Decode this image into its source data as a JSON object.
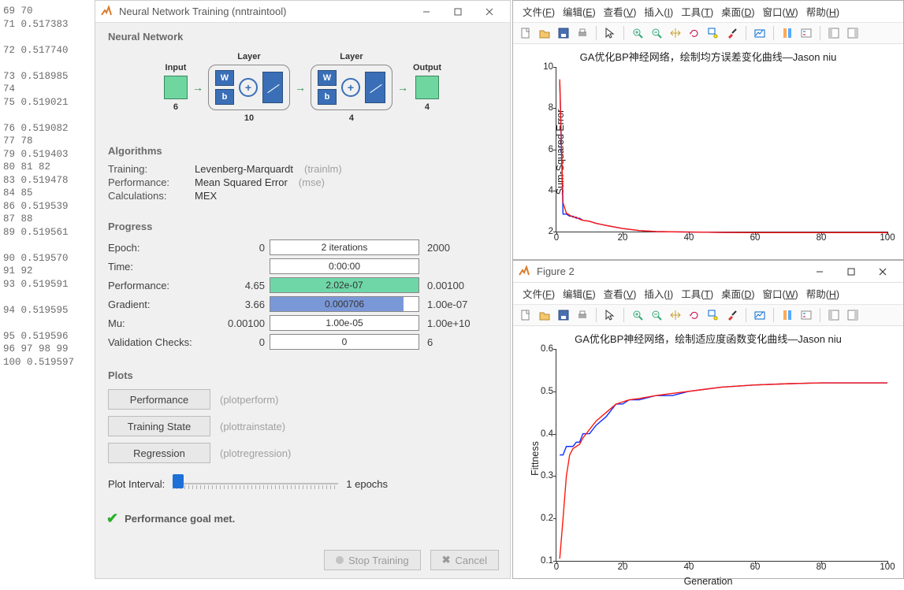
{
  "left_column_text": "69 70\n71 0.517383\n\n72 0.517740\n\n73 0.518985\n74\n75 0.519021\n\n76 0.519082\n77 78\n79 0.519403\n80 81 82\n83 0.519478\n84 85\n86 0.519539\n87 88\n89 0.519561\n\n90 0.519570\n91 92\n93 0.519591\n\n94 0.519595\n\n95 0.519596\n96 97 98 99\n100 0.519597",
  "nntrain": {
    "window_title": "Neural Network Training (nntraintool)",
    "sections": {
      "nn": "Neural Network",
      "algo": "Algorithms",
      "progress": "Progress",
      "plots": "Plots"
    },
    "diagram": {
      "input_label": "Input",
      "input_n": "6",
      "layer_label": "Layer",
      "w_label": "W",
      "b_label": "b",
      "plus": "+",
      "hidden_n": "10",
      "output_layer_n": "4",
      "output_label": "Output",
      "output_n": "4"
    },
    "algorithms": {
      "training_k": "Training:",
      "training_v": "Levenberg-Marquardt",
      "training_h": "(trainlm)",
      "perf_k": "Performance:",
      "perf_v": "Mean Squared Error",
      "perf_h": "(mse)",
      "calc_k": "Calculations:",
      "calc_v": "MEX"
    },
    "progress": {
      "epoch": {
        "k": "Epoch:",
        "start": "0",
        "text": "2 iterations",
        "end": "2000",
        "fill_pct": 0,
        "fill_color": ""
      },
      "time": {
        "k": "Time:",
        "start": "",
        "text": "0:00:00",
        "end": "",
        "fill_pct": 0,
        "fill_color": ""
      },
      "perf": {
        "k": "Performance:",
        "start": "4.65",
        "text": "2.02e-07",
        "end": "0.00100",
        "fill_pct": 100,
        "fill_color": "#6fd6a8"
      },
      "grad": {
        "k": "Gradient:",
        "start": "3.66",
        "text": "0.000706",
        "end": "1.00e-07",
        "fill_pct": 90,
        "fill_color": "#7a98d8"
      },
      "mu": {
        "k": "Mu:",
        "start": "0.00100",
        "text": "1.00e-05",
        "end": "1.00e+10",
        "fill_pct": 0,
        "fill_color": ""
      },
      "valid": {
        "k": "Validation Checks:",
        "start": "0",
        "text": "0",
        "end": "6",
        "fill_pct": 0,
        "fill_color": ""
      }
    },
    "plot_buttons": {
      "perf": {
        "label": "Performance",
        "hint": "(plotperform)"
      },
      "state": {
        "label": "Training State",
        "hint": "(plottrainstate)"
      },
      "reg": {
        "label": "Regression",
        "hint": "(plotregression)"
      }
    },
    "plot_interval": {
      "label": "Plot Interval:",
      "value_text": "1 epochs"
    },
    "status": "Performance goal met.",
    "buttons": {
      "stop": "Stop Training",
      "cancel": "Cancel"
    }
  },
  "figure_menus": [
    "文件(F)",
    "编辑(E)",
    "查看(V)",
    "插入(I)",
    "工具(T)",
    "桌面(D)",
    "窗口(W)",
    "帮助(H)"
  ],
  "fig2_title": "Figure 2",
  "toolbar_icons": [
    "new-file-icon",
    "open-folder-icon",
    "save-icon",
    "print-icon",
    "sep",
    "pointer-icon",
    "sep",
    "zoom-in-icon",
    "zoom-out-icon",
    "pan-icon",
    "rotate-icon",
    "data-cursor-icon",
    "brush-icon",
    "sep",
    "link-plot-icon",
    "sep",
    "colorbar-icon",
    "legend-icon",
    "sep",
    "hide-plot-tools-icon",
    "show-plot-tools-icon"
  ],
  "chart_data": [
    {
      "type": "line",
      "title": "GA优化BP神经网络，绘制均方误差变化曲线—Jason niu",
      "xlabel": "",
      "ylabel": "Sum-Squared Error",
      "xlim": [
        0,
        100
      ],
      "ylim": [
        2,
        10
      ],
      "xticks": [
        0,
        20,
        40,
        60,
        80,
        100
      ],
      "yticks": [
        2,
        4,
        6,
        8,
        10
      ],
      "x": [
        1,
        2,
        3,
        4,
        5,
        6,
        7,
        8,
        10,
        12,
        15,
        20,
        25,
        30,
        40,
        50,
        60,
        70,
        80,
        90,
        100
      ],
      "series": [
        {
          "name": "best",
          "color": "#1030ff",
          "values": [
            9.3,
            2.85,
            2.85,
            2.75,
            2.75,
            2.65,
            2.65,
            2.55,
            2.5,
            2.4,
            2.3,
            2.15,
            2.05,
            2.0,
            1.98,
            1.96,
            1.95,
            1.95,
            1.95,
            1.95,
            1.95
          ]
        },
        {
          "name": "curr",
          "color": "#ff1810",
          "values": [
            9.4,
            3.4,
            2.9,
            2.8,
            2.7,
            2.7,
            2.6,
            2.55,
            2.5,
            2.4,
            2.3,
            2.15,
            2.05,
            2.0,
            1.98,
            1.96,
            1.95,
            1.95,
            1.95,
            1.95,
            1.95
          ]
        }
      ]
    },
    {
      "type": "line",
      "title": "GA优化BP神经网络，绘制适应度函数变化曲线—Jason niu",
      "xlabel": "Generation",
      "ylabel": "Fittness",
      "xlim": [
        0,
        100
      ],
      "ylim": [
        0.1,
        0.6
      ],
      "xticks": [
        0,
        20,
        40,
        60,
        80,
        100
      ],
      "yticks": [
        0.1,
        0.2,
        0.3,
        0.4,
        0.5,
        0.6
      ],
      "x": [
        1,
        2,
        3,
        4,
        5,
        6,
        7,
        8,
        10,
        12,
        15,
        18,
        20,
        22,
        25,
        30,
        35,
        40,
        50,
        60,
        70,
        80,
        90,
        100
      ],
      "series": [
        {
          "name": "best",
          "color": "#1030ff",
          "values": [
            0.35,
            0.35,
            0.37,
            0.37,
            0.37,
            0.38,
            0.38,
            0.4,
            0.4,
            0.42,
            0.44,
            0.47,
            0.47,
            0.48,
            0.48,
            0.49,
            0.49,
            0.5,
            0.51,
            0.515,
            0.518,
            0.52,
            0.52,
            0.52
          ]
        },
        {
          "name": "curr",
          "color": "#ff1810",
          "values": [
            0.105,
            0.2,
            0.3,
            0.35,
            0.365,
            0.37,
            0.375,
            0.39,
            0.41,
            0.43,
            0.45,
            0.47,
            0.475,
            0.48,
            0.483,
            0.49,
            0.495,
            0.5,
            0.51,
            0.515,
            0.518,
            0.52,
            0.52,
            0.52
          ]
        }
      ]
    }
  ]
}
